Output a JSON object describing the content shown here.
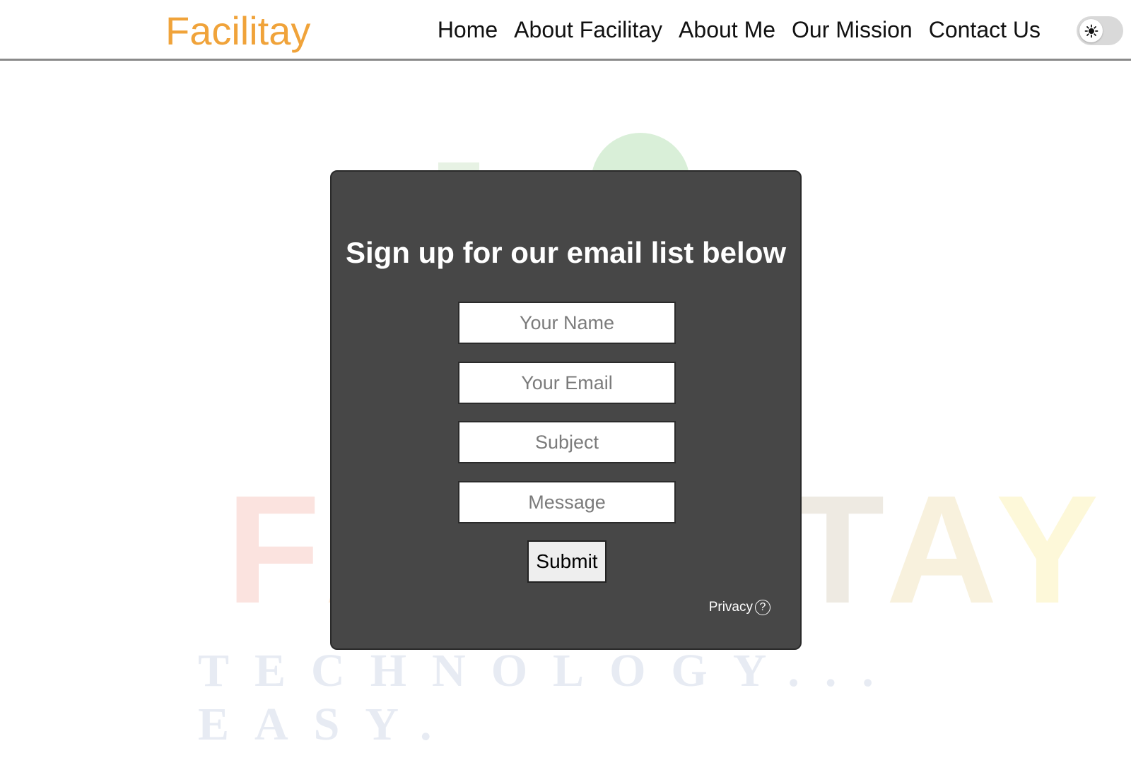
{
  "header": {
    "brand": "Facilitay",
    "nav": [
      "Home",
      "About Facilitay",
      "About Me",
      "Our Mission",
      "Contact Us"
    ],
    "theme_toggle_icon": "sun-icon"
  },
  "watermark": {
    "word": "FACILITAY",
    "tagline": "TECHNOLOGY... EASY."
  },
  "form": {
    "title": "Sign up for our email list below",
    "name_placeholder": "Your Name",
    "email_placeholder": "Your Email",
    "subject_placeholder": "Subject",
    "message_placeholder": "Message",
    "submit_label": "Submit",
    "privacy_label": "Privacy",
    "privacy_icon": "?"
  },
  "colors": {
    "brand": "#f0a33a",
    "card": "#474747"
  }
}
